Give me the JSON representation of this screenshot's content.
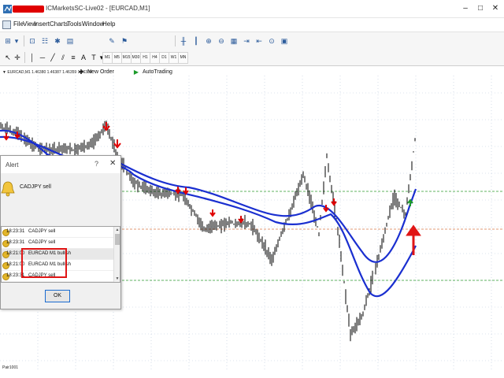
{
  "window": {
    "title": "ICMarketsSC-Live02 - [EURCAD,M1]",
    "buttons": [
      "–",
      "□",
      "✕"
    ]
  },
  "menu": [
    "File",
    "View",
    "Insert",
    "Charts",
    "Tools",
    "Window",
    "Help"
  ],
  "toolbar": {
    "new_order": "New Order",
    "autotrading": "AutoTrading"
  },
  "timeframes": [
    "M1",
    "M5",
    "M15",
    "M30",
    "H1",
    "H4",
    "D1",
    "W1",
    "MN"
  ],
  "chart": {
    "info": "▼ EURCAD,M1 1.46380 1.46387 1.46359 1.46388",
    "bottom_label": "Pair1001",
    "colors": {
      "candle": "#000000",
      "ma": "#1a2fd0",
      "arrow": "#e00000",
      "level_green": "#2e9a2e",
      "level_red": "#d87a4a",
      "grid": "#b8c8dc"
    }
  },
  "alert": {
    "title": "Alert",
    "help": "?",
    "close": "✕",
    "message": "CADJPY sell",
    "rows": [
      {
        "time": "18:23:31",
        "text": "CADJPY sell"
      },
      {
        "time": "18:23:31",
        "text": "CADJPY sell"
      },
      {
        "time": "18:21:00",
        "text": "EURCAD M1 bullish"
      },
      {
        "time": "18:21:00",
        "text": "EURCAD M1 bullish"
      },
      {
        "time": "18:23:31",
        "text": "CADJPY sell"
      }
    ],
    "ok": "OK"
  }
}
